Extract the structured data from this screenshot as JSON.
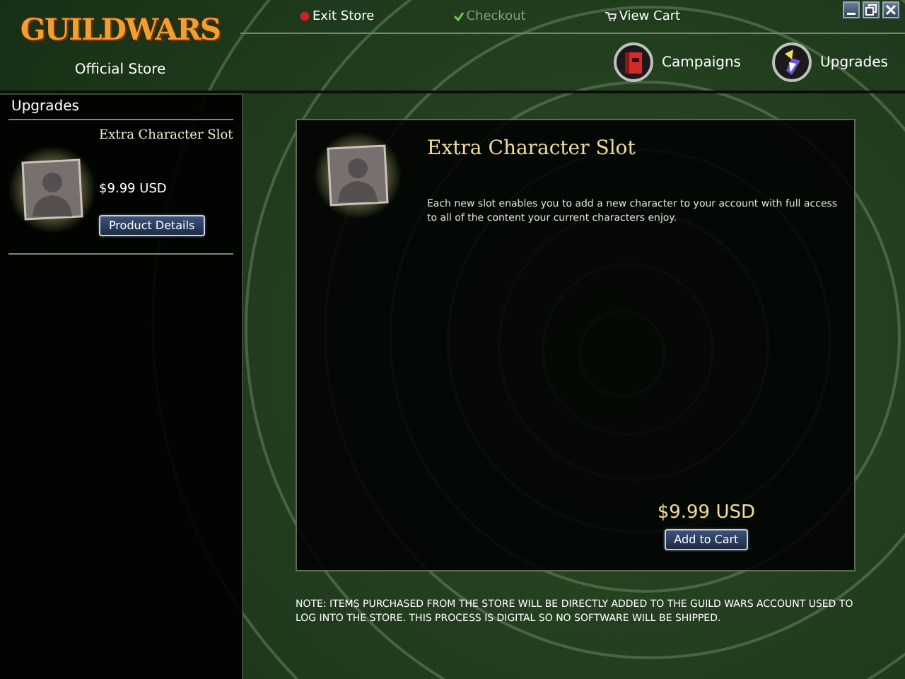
{
  "store": {
    "logo": "GUILDWARS",
    "subtitle": "Official Store"
  },
  "top_links": [
    {
      "label": "Exit Store",
      "kind": "exit",
      "disabled": false
    },
    {
      "label": "Checkout",
      "kind": "checkout",
      "disabled": true
    },
    {
      "label": "View Cart",
      "kind": "cart",
      "disabled": false
    }
  ],
  "window_controls": [
    {
      "kind": "minimize"
    },
    {
      "kind": "restore"
    },
    {
      "kind": "close"
    }
  ],
  "nav": [
    {
      "label": "Campaigns",
      "kind": "campaigns"
    },
    {
      "label": "Upgrades",
      "kind": "upgrades"
    }
  ],
  "sidebar": {
    "title": "Upgrades",
    "items": [
      {
        "name": "Extra Character Slot",
        "price": "$9.99 USD",
        "button": "Product Details"
      }
    ]
  },
  "product": {
    "name": "Extra Character Slot",
    "description": "Each new slot enables you to add a new character to your account with full access to all of the content your current characters enjoy.",
    "price": "$9.99 USD",
    "button": "Add to Cart"
  },
  "note": "NOTE: ITEMS PURCHASED FROM THE STORE WILL BE DIRECTLY ADDED TO THE GUILD WARS ACCOUNT USED TO LOG INTO THE STORE. THIS PROCESS IS DIGITAL SO NO SOFTWARE WILL BE SHIPPED."
}
